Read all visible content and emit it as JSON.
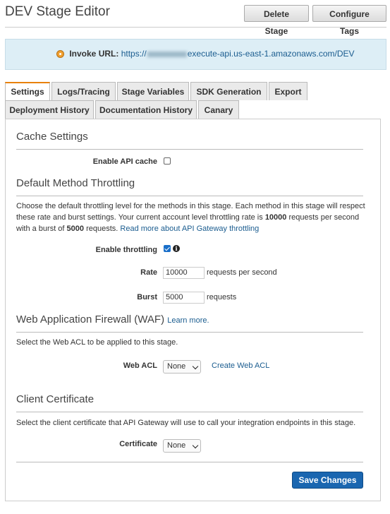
{
  "header": {
    "title": "DEV Stage Editor",
    "delete_label": "Delete Stage",
    "configure_tags_label": "Configure Tags"
  },
  "invoke": {
    "label": "Invoke URL:",
    "url_prefix": "https://",
    "url_suffix": "execute-api.us-east-1.amazonaws.com/DEV"
  },
  "tabs": {
    "row1": [
      "Settings",
      "Logs/Tracing",
      "Stage Variables",
      "SDK Generation",
      "Export"
    ],
    "row2": [
      "Deployment History",
      "Documentation History",
      "Canary"
    ],
    "active": "Settings"
  },
  "cache": {
    "heading": "Cache Settings",
    "enable_label": "Enable API cache",
    "enabled": false
  },
  "throttling": {
    "heading": "Default Method Throttling",
    "description_1": "Choose the default throttling level for the methods in this stage. Each method in this stage will respect these rate and burst settings. Your current account level throttling rate is ",
    "account_rate": "10000",
    "description_2": " requests per second with a burst of ",
    "account_burst": "5000",
    "description_3": " requests. ",
    "read_more_link": "Read more about API Gateway throttling",
    "enable_label": "Enable throttling",
    "enabled": true,
    "rate_label": "Rate",
    "rate_value": "10000",
    "rate_unit": "requests per second",
    "burst_label": "Burst",
    "burst_value": "5000",
    "burst_unit": "requests"
  },
  "waf": {
    "heading": "Web Application Firewall (WAF)",
    "learn_more": "Learn more.",
    "description": "Select the Web ACL to be applied to this stage.",
    "acl_label": "Web ACL",
    "acl_value": "None",
    "create_link": "Create Web ACL"
  },
  "certificate": {
    "heading": "Client Certificate",
    "description": "Select the client certificate that API Gateway will use to call your integration endpoints in this stage.",
    "label": "Certificate",
    "value": "None"
  },
  "footer": {
    "save_label": "Save Changes"
  },
  "colors": {
    "accent_tab": "#e8820c",
    "primary_button": "#1a66b0",
    "link": "#1a5c8f",
    "info_bg": "#ddeef6"
  }
}
